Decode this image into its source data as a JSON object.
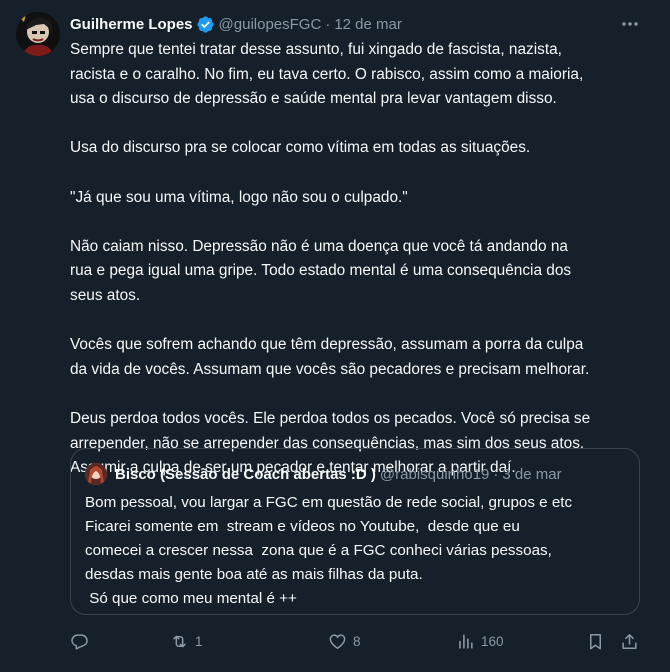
{
  "tweet": {
    "author": {
      "display_name": "Guilherme Lopes",
      "handle": "@guilopesFGC",
      "date": "12 de mar",
      "verified": true
    },
    "separator": "·",
    "paragraphs": [
      [
        "Sempre que tentei tratar desse assunto, fui xingado de fascista, nazista,",
        "racista e o caralho. No fim, eu tava certo. O rabisco, assim como a maioria,",
        "usa o discurso de depressão e saúde mental pra levar vantagem disso."
      ],
      [
        "Usa do discurso pra se colocar como vítima em todas as situações."
      ],
      [
        "\"Já que sou uma vítima, logo não sou o culpado.\""
      ],
      [
        "Não caiam nisso. Depressão não é uma doença que você tá andando na",
        "rua e pega igual uma gripe. Todo estado mental é uma consequência dos",
        "seus atos."
      ],
      [
        "Vocês que sofrem achando que têm depressão, assumam a porra da culpa",
        "da vida de vocês. Assumam que vocês são pecadores e precisam melhorar."
      ],
      [
        "Deus perdoa todos vocês. Ele perdoa todos os pecados. Você só precisa se",
        "arrepender, não se arrepender das consequências, mas sim dos seus atos.",
        "Assumir a culpa de ser um pecador e tentar melhorar a partir daí."
      ]
    ],
    "quote": {
      "display_name": "Bisco (Sessão de Coach abertas :D )",
      "handle": "@rabisquinho19",
      "date": "3 de mar",
      "lines": [
        "Bom pessoal, vou largar a FGC em questão de rede social, grupos e etc",
        "Ficarei somente em  stream e vídeos no Youtube,  desde que eu",
        "comecei a crescer nessa  zona que é a FGC conheci várias pessoas,",
        "desdas mais gente boa até as mais filhas da puta.",
        " Só que como meu mental é ++"
      ]
    },
    "actions": {
      "reply_count": "",
      "retweet_count": "1",
      "like_count": "8",
      "views_count": "160"
    }
  },
  "colors": {
    "background": "#15202b",
    "text": "#f7f9f9",
    "muted": "#8b98a5",
    "border": "#38444d",
    "verified": "#1d9bf0"
  },
  "icons": [
    "verified-badge-icon",
    "more-icon",
    "reply-icon",
    "retweet-icon",
    "like-icon",
    "views-icon",
    "bookmark-icon",
    "share-icon"
  ]
}
